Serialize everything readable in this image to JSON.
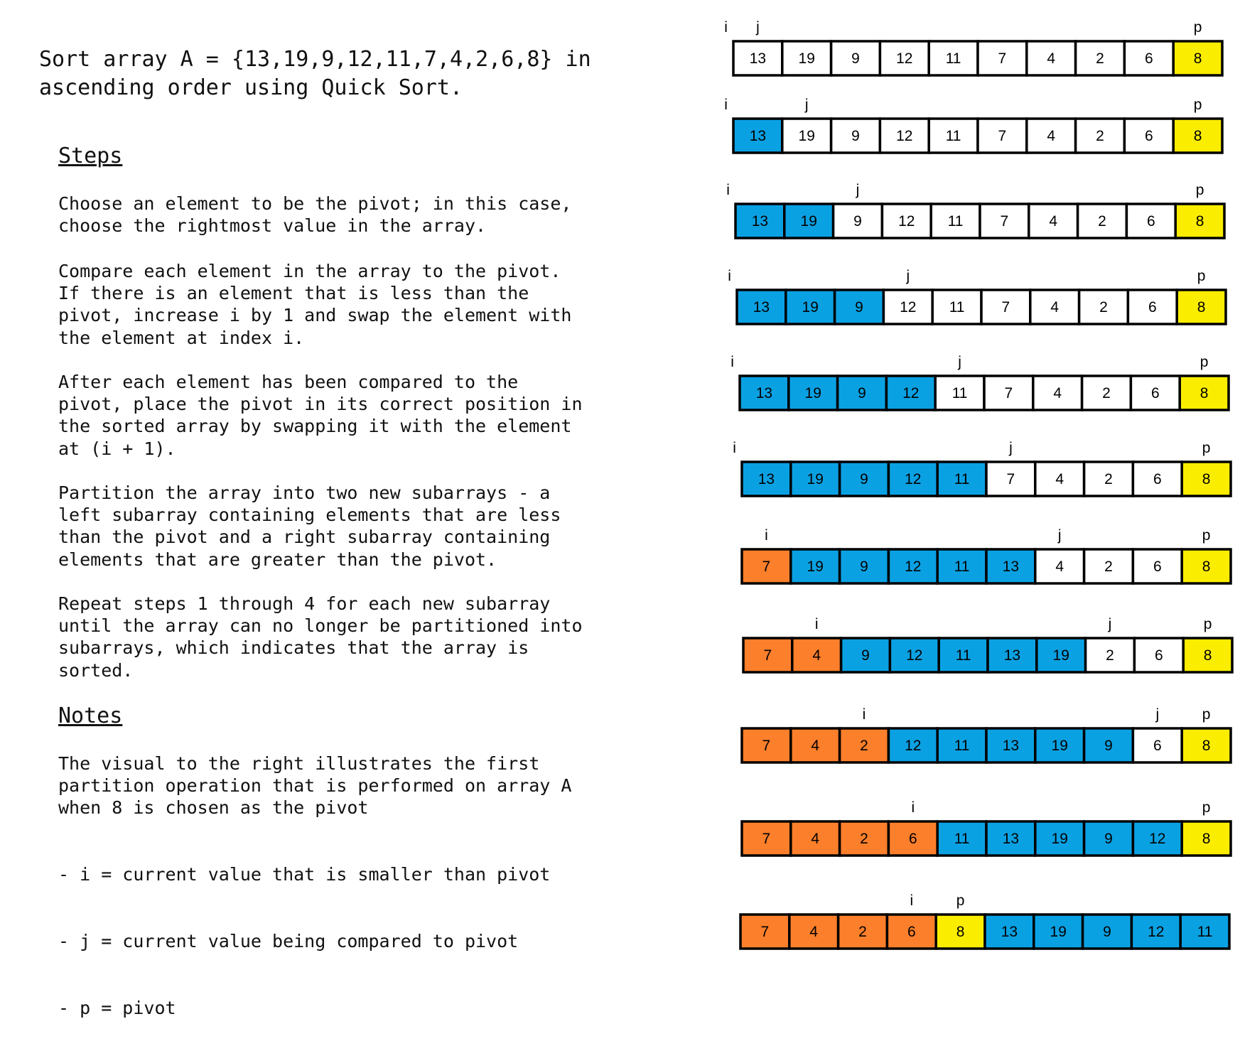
{
  "title": "Sort array A = {13,19,9,12,11,7,4,2,6,8} in\nascending order using Quick Sort.",
  "steps": {
    "heading": "Steps",
    "items": [
      "Choose an element to be the pivot; in this case,\nchoose the rightmost value in the array.",
      "Compare each element in the array to the pivot.\nIf there is an element that is less than the\npivot, increase i by 1 and swap the element with\nthe element at index i.",
      "After each element has been compared to the\npivot, place the pivot in its correct position in\nthe sorted array by swapping it with the element\nat (i + 1).",
      "Partition the array into two new subarrays - a\nleft subarray containing elements that are less\nthan the pivot and a right subarray containing\nelements that are greater than the pivot.",
      "Repeat steps 1 through 4 for each new subarray\nuntil the array can no longer be partitioned into\nsubarrays, which indicates that the array is\nsorted."
    ]
  },
  "notes": {
    "heading": "Notes",
    "body": "The visual to the right illustrates the first\npartition operation that is performed on array A\nwhen 8 is chosen as the pivot",
    "items": [
      "- i = current value that is smaller than pivot",
      "- j = current value being compared to pivot",
      "- p = pivot"
    ]
  },
  "colors": {
    "white": "#ffffff",
    "blue": "#0aa1e3",
    "orange": "#fc7f2b",
    "yellow": "#fbed00",
    "border": "#000000"
  },
  "diagram": {
    "color_key": {
      "w": "white",
      "b": "blue",
      "o": "orange",
      "y": "yellow"
    },
    "rows": [
      {
        "values": [
          13,
          19,
          9,
          12,
          11,
          7,
          4,
          2,
          6,
          8
        ],
        "colors": [
          "w",
          "w",
          "w",
          "w",
          "w",
          "w",
          "w",
          "w",
          "w",
          "y"
        ],
        "markers": [
          {
            "label": "i",
            "pos": -1
          },
          {
            "label": "j",
            "pos": 0
          },
          {
            "label": "p",
            "pos": 9
          }
        ]
      },
      {
        "values": [
          13,
          19,
          9,
          12,
          11,
          7,
          4,
          2,
          6,
          8
        ],
        "colors": [
          "b",
          "w",
          "w",
          "w",
          "w",
          "w",
          "w",
          "w",
          "w",
          "y"
        ],
        "markers": [
          {
            "label": "i",
            "pos": -1
          },
          {
            "label": "j",
            "pos": 1
          },
          {
            "label": "p",
            "pos": 9
          }
        ]
      },
      {
        "values": [
          13,
          19,
          9,
          12,
          11,
          7,
          4,
          2,
          6,
          8
        ],
        "colors": [
          "b",
          "b",
          "w",
          "w",
          "w",
          "w",
          "w",
          "w",
          "w",
          "y"
        ],
        "markers": [
          {
            "label": "i",
            "pos": -1
          },
          {
            "label": "j",
            "pos": 2
          },
          {
            "label": "p",
            "pos": 9
          }
        ]
      },
      {
        "values": [
          13,
          19,
          9,
          12,
          11,
          7,
          4,
          2,
          6,
          8
        ],
        "colors": [
          "b",
          "b",
          "b",
          "w",
          "w",
          "w",
          "w",
          "w",
          "w",
          "y"
        ],
        "markers": [
          {
            "label": "i",
            "pos": -1
          },
          {
            "label": "j",
            "pos": 3
          },
          {
            "label": "p",
            "pos": 9
          }
        ]
      },
      {
        "values": [
          13,
          19,
          9,
          12,
          11,
          7,
          4,
          2,
          6,
          8
        ],
        "colors": [
          "b",
          "b",
          "b",
          "b",
          "w",
          "w",
          "w",
          "w",
          "w",
          "y"
        ],
        "markers": [
          {
            "label": "i",
            "pos": -1
          },
          {
            "label": "j",
            "pos": 4
          },
          {
            "label": "p",
            "pos": 9
          }
        ]
      },
      {
        "values": [
          13,
          19,
          9,
          12,
          11,
          7,
          4,
          2,
          6,
          8
        ],
        "colors": [
          "b",
          "b",
          "b",
          "b",
          "b",
          "w",
          "w",
          "w",
          "w",
          "y"
        ],
        "markers": [
          {
            "label": "i",
            "pos": -1
          },
          {
            "label": "j",
            "pos": 5
          },
          {
            "label": "p",
            "pos": 9
          }
        ]
      },
      {
        "values": [
          7,
          19,
          9,
          12,
          11,
          13,
          4,
          2,
          6,
          8
        ],
        "colors": [
          "o",
          "b",
          "b",
          "b",
          "b",
          "b",
          "w",
          "w",
          "w",
          "y"
        ],
        "markers": [
          {
            "label": "i",
            "pos": 0
          },
          {
            "label": "j",
            "pos": 6
          },
          {
            "label": "p",
            "pos": 9
          }
        ]
      },
      {
        "values": [
          7,
          4,
          9,
          12,
          11,
          13,
          19,
          2,
          6,
          8
        ],
        "colors": [
          "o",
          "o",
          "b",
          "b",
          "b",
          "b",
          "b",
          "w",
          "w",
          "y"
        ],
        "markers": [
          {
            "label": "i",
            "pos": 1
          },
          {
            "label": "j",
            "pos": 7
          },
          {
            "label": "p",
            "pos": 9
          }
        ]
      },
      {
        "values": [
          7,
          4,
          2,
          12,
          11,
          13,
          19,
          9,
          6,
          8
        ],
        "colors": [
          "o",
          "o",
          "o",
          "b",
          "b",
          "b",
          "b",
          "b",
          "w",
          "y"
        ],
        "markers": [
          {
            "label": "i",
            "pos": 2
          },
          {
            "label": "j",
            "pos": 8
          },
          {
            "label": "p",
            "pos": 9
          }
        ]
      },
      {
        "values": [
          7,
          4,
          2,
          6,
          11,
          13,
          19,
          9,
          12,
          8
        ],
        "colors": [
          "o",
          "o",
          "o",
          "o",
          "b",
          "b",
          "b",
          "b",
          "b",
          "y"
        ],
        "markers": [
          {
            "label": "i",
            "pos": 3
          },
          {
            "label": "p",
            "pos": 9
          }
        ]
      },
      {
        "values": [
          7,
          4,
          2,
          6,
          8,
          13,
          19,
          9,
          12,
          11
        ],
        "colors": [
          "o",
          "o",
          "o",
          "o",
          "y",
          "b",
          "b",
          "b",
          "b",
          "b"
        ],
        "markers": [
          {
            "label": "i",
            "pos": 3
          },
          {
            "label": "p",
            "pos": 4
          }
        ]
      }
    ]
  }
}
